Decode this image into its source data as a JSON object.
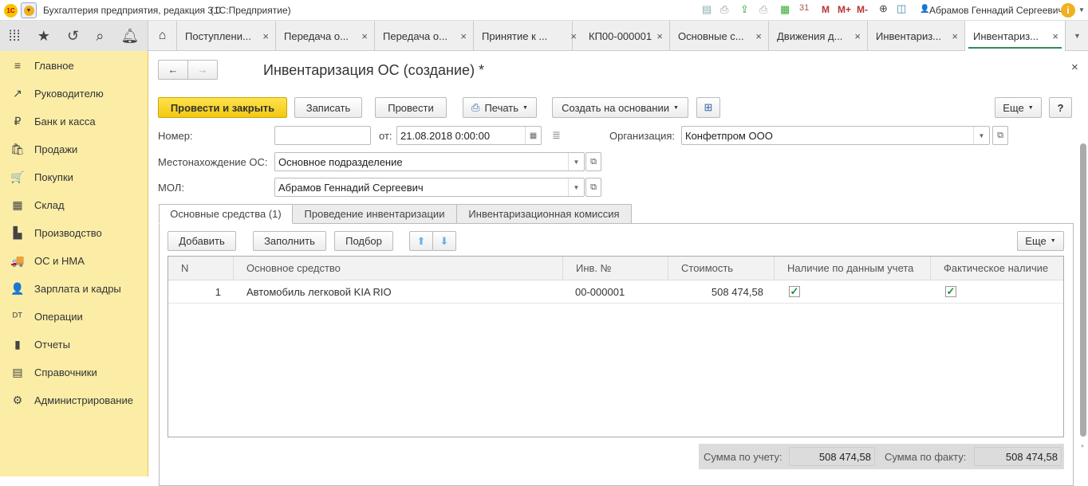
{
  "titlebar": {
    "app_title": "Бухгалтерия предприятия, редакция 3.0",
    "platform": "(1С:Предприятие)",
    "user": "Абрамов Геннадий Сергеевич",
    "m": "M",
    "mplus": "M+",
    "mminus": "M-"
  },
  "tabs": [
    {
      "label": "Поступлени..."
    },
    {
      "label": "Передача о..."
    },
    {
      "label": "Передача о..."
    },
    {
      "label": "Принятие к ..."
    },
    {
      "label": "КП00-000001"
    },
    {
      "label": "Основные с..."
    },
    {
      "label": "Движения д..."
    },
    {
      "label": "Инвентариз..."
    },
    {
      "label": "Инвентариз..."
    }
  ],
  "sidebar": {
    "items": [
      {
        "label": "Главное",
        "icon": "≡"
      },
      {
        "label": "Руководителю",
        "icon": "↗"
      },
      {
        "label": "Банк и касса",
        "icon": "₽"
      },
      {
        "label": "Продажи",
        "icon": "🛍"
      },
      {
        "label": "Покупки",
        "icon": "🛒"
      },
      {
        "label": "Склад",
        "icon": "▦"
      },
      {
        "label": "Производство",
        "icon": "▙"
      },
      {
        "label": "ОС и НМА",
        "icon": "🚚"
      },
      {
        "label": "Зарплата и кадры",
        "icon": "👤"
      },
      {
        "label": "Операции",
        "icon": "ᴰᵀ"
      },
      {
        "label": "Отчеты",
        "icon": "▮"
      },
      {
        "label": "Справочники",
        "icon": "▤"
      },
      {
        "label": "Администрирование",
        "icon": "⚙"
      }
    ]
  },
  "form": {
    "title": "Инвентаризация ОС (создание) *",
    "buttons": {
      "post_close": "Провести и закрыть",
      "save": "Записать",
      "post": "Провести",
      "print": "Печать",
      "create_based": "Создать на основании",
      "more": "Еще",
      "help": "?"
    },
    "number_label": "Номер:",
    "number_value": "",
    "date_label": "от:",
    "date_value": "21.08.2018  0:00:00",
    "org_label": "Организация:",
    "org_value": "Конфетпром ООО",
    "location_label": "Местонахождение ОС:",
    "location_value": "Основное подразделение",
    "mol_label": "МОЛ:",
    "mol_value": "Абрамов Геннадий Сергеевич",
    "form_tabs": [
      {
        "label": "Основные средства (1)"
      },
      {
        "label": "Проведение инвентаризации"
      },
      {
        "label": "Инвентаризационная комиссия"
      }
    ],
    "table_buttons": {
      "add": "Добавить",
      "fill": "Заполнить",
      "pick": "Подбор",
      "more": "Еще"
    },
    "table": {
      "columns": [
        "N",
        "Основное средство",
        "Инв. №",
        "Стоимость",
        "Наличие по данным учета",
        "Фактическое наличие"
      ],
      "rows": [
        {
          "n": "1",
          "asset": "Автомобиль легковой KIA RIO",
          "inv": "00-000001",
          "cost": "508 474,58",
          "book": true,
          "fact": true
        }
      ]
    },
    "totals": {
      "book_label": "Сумма по учету:",
      "book_value": "508 474,58",
      "fact_label": "Сумма по факту:",
      "fact_value": "508 474,58"
    }
  }
}
